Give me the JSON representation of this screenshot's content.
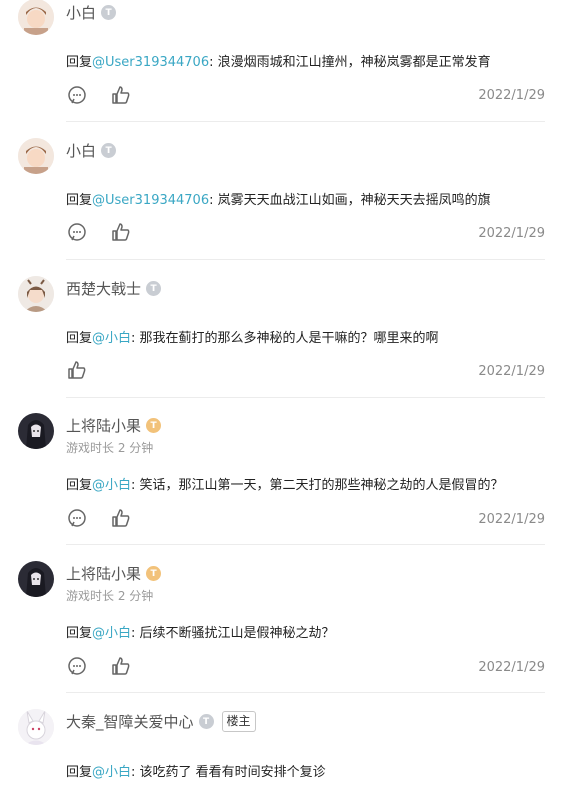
{
  "reply_prefix": "回复",
  "comments": [
    {
      "author": "小白",
      "level_badge": "T",
      "playtime": "",
      "mention": "@User319344706",
      "text": ": 浪漫烟雨城和江山撞州，神秘岚雾都是正常发育",
      "date": "2022/1/29",
      "host_tag": ""
    },
    {
      "author": "小白",
      "level_badge": "T",
      "playtime": "",
      "mention": "@User319344706",
      "text": ": 岚雾天天血战江山如画，神秘天天去摇凤鸣的旗",
      "date": "2022/1/29",
      "host_tag": ""
    },
    {
      "author": "西楚大戟士",
      "level_badge": "T",
      "playtime": "",
      "mention": "@小白",
      "text": ": 那我在蓟打的那么多神秘的人是干嘛的？哪里来的啊",
      "date": "2022/1/29",
      "host_tag": ""
    },
    {
      "author": "上将陆小果",
      "level_badge": "T",
      "playtime": "游戏时长 2 分钟",
      "mention": "@小白",
      "text": ": 笑话，那江山第一天，第二天打的那些神秘之劫的人是假冒的？",
      "date": "2022/1/29",
      "host_tag": ""
    },
    {
      "author": "上将陆小果",
      "level_badge": "T",
      "playtime": "游戏时长 2 分钟",
      "mention": "@小白",
      "text": ": 后续不断骚扰江山是假神秘之劫？",
      "date": "2022/1/29",
      "host_tag": ""
    },
    {
      "author": "大秦_智障关爱中心",
      "level_badge": "T",
      "playtime": "",
      "mention": "@小白",
      "text": ": 该吃药了 看看有时间安排个复诊",
      "date": "",
      "host_tag": "楼主"
    }
  ],
  "colors": {
    "mention": "#3aa7c4",
    "badge_grey": "#c9cdd3",
    "badge_gold": "#f2c27a"
  }
}
